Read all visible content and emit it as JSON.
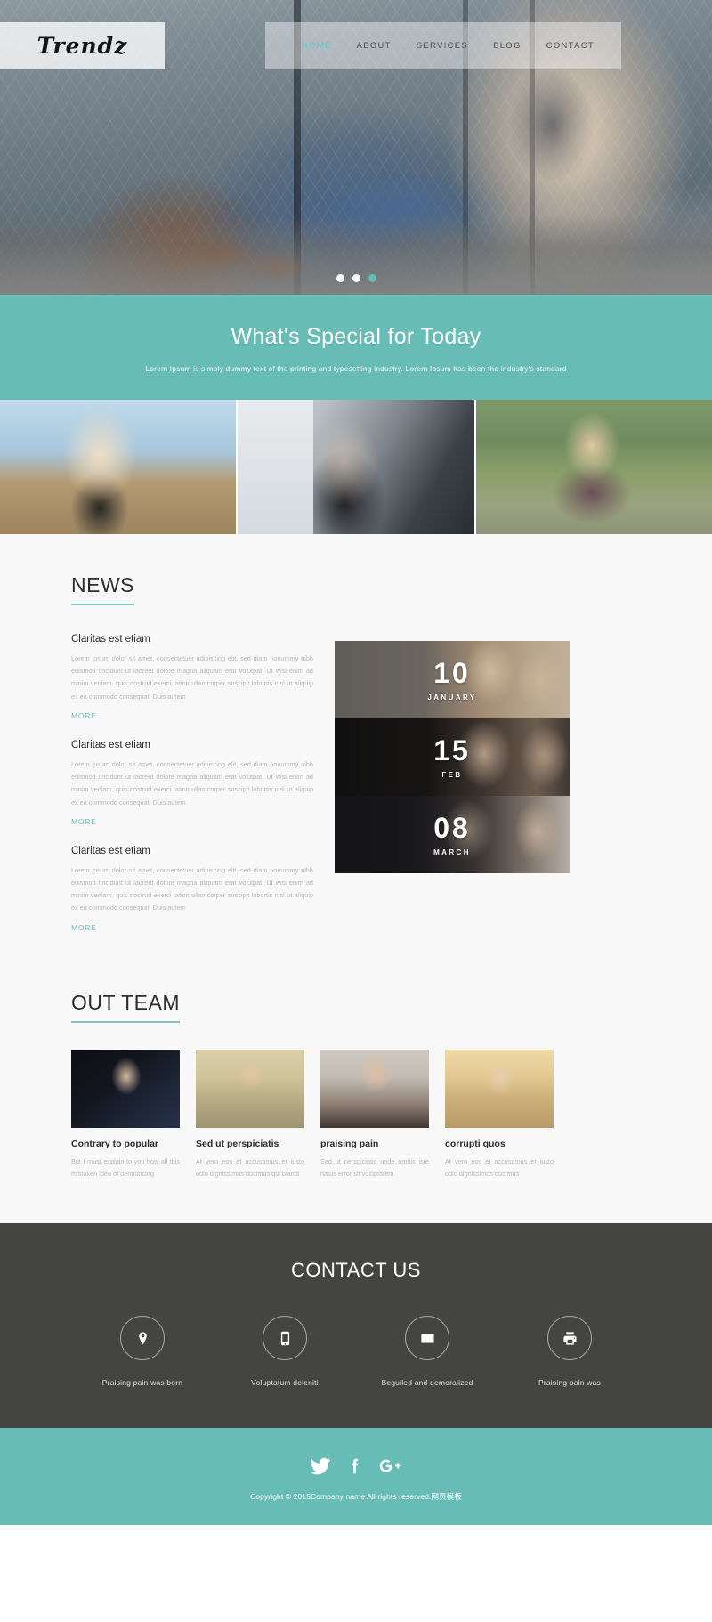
{
  "header": {
    "logo": "Trendz",
    "nav": [
      {
        "label": "HOME",
        "active": true
      },
      {
        "label": "ABOUT",
        "active": false
      },
      {
        "label": "SERVICES",
        "active": false
      },
      {
        "label": "BLOG",
        "active": false
      },
      {
        "label": "CONTACT",
        "active": false
      }
    ]
  },
  "slider": {
    "dots": 3,
    "active_index": 2
  },
  "special": {
    "title": "What's Special for Today",
    "subtitle": "Lorem Ipsum is simply dummy text of the printing and typesetting industry. Lorem Ipsum has been the industry's standard"
  },
  "news": {
    "heading": "NEWS",
    "items": [
      {
        "title": "Claritas est etiam",
        "body": "Lorem ipsum dolor sit amet, consectetuer adipiscing elit, sed diam nonummy nibh euismod tincidunt ut laoreet dolore magna aliquam erat volutpat. Ut wisi enim ad minim veniam, quis nostrud exerci tation ullamcorper suscipit lobortis nisl ut aliquip ex ea commodo consequat. Duis autem",
        "more": "MORE"
      },
      {
        "title": "Claritas est etiam",
        "body": "Lorem ipsum dolor sit amet, consectetuer adipiscing elit, sed diam nonummy nibh euismod tincidunt ut laoreet dolore magna aliquam erat volutpat. Ut wisi enim ad minim veniam, quis nostrud exerci tation ullamcorper suscipit lobortis nisl ut aliquip ex ea commodo consequat. Duis autem",
        "more": "MORE"
      },
      {
        "title": "Claritas est etiam",
        "body": "Lorem ipsum dolor sit amet, consectetuer adipiscing elit, sed diam nonummy nibh euismod tincidunt ut laoreet dolore magna aliquam erat volutpat. Ut wisi enim ad minim veniam, quis nostrud exerci tation ullamcorper suscipit lobortis nisl ut aliquip ex ea commodo consequat. Duis autem",
        "more": "MORE"
      }
    ],
    "dates": [
      {
        "day": "10",
        "month": "JANUARY"
      },
      {
        "day": "15",
        "month": "FEB"
      },
      {
        "day": "08",
        "month": "MARCH"
      }
    ]
  },
  "team": {
    "heading": "OUT TEAM",
    "members": [
      {
        "name": "Contrary to popular",
        "desc": "But I must explain to you how all this mistaken idea of denouncing"
      },
      {
        "name": "Sed ut perspiciatis",
        "desc": "At vero eos et accusamus et iusto odio dignissimos ducimus qui blandi"
      },
      {
        "name": "praising pain",
        "desc": "Sed ut perspiciatis unde omnis iste natus error sit voluptatem"
      },
      {
        "name": "corrupti quos",
        "desc": "At vero eos et accusamus et iusto odio dignissimos ducimus"
      }
    ]
  },
  "contact": {
    "heading": "CONTACT US",
    "items": [
      {
        "icon": "location-pin-icon",
        "label": "Praising pain was born"
      },
      {
        "icon": "mobile-phone-icon",
        "label": "Voluptatum deleniti"
      },
      {
        "icon": "envelope-icon",
        "label": "Beguiled and demoralized"
      },
      {
        "icon": "printer-icon",
        "label": "Praising pain was"
      }
    ]
  },
  "footer": {
    "socials": [
      {
        "icon": "twitter-icon",
        "name": "Twitter"
      },
      {
        "icon": "facebook-icon",
        "name": "Facebook"
      },
      {
        "icon": "google-plus-icon",
        "name": "Google Plus"
      }
    ],
    "copyright": "Copyright © 2015Company name All rights reserved.网页模板"
  },
  "colors": {
    "teal": "#67bcb5",
    "nav_active": "#5ec9cf",
    "dark": "#444443",
    "link": "#6fbdb6"
  }
}
